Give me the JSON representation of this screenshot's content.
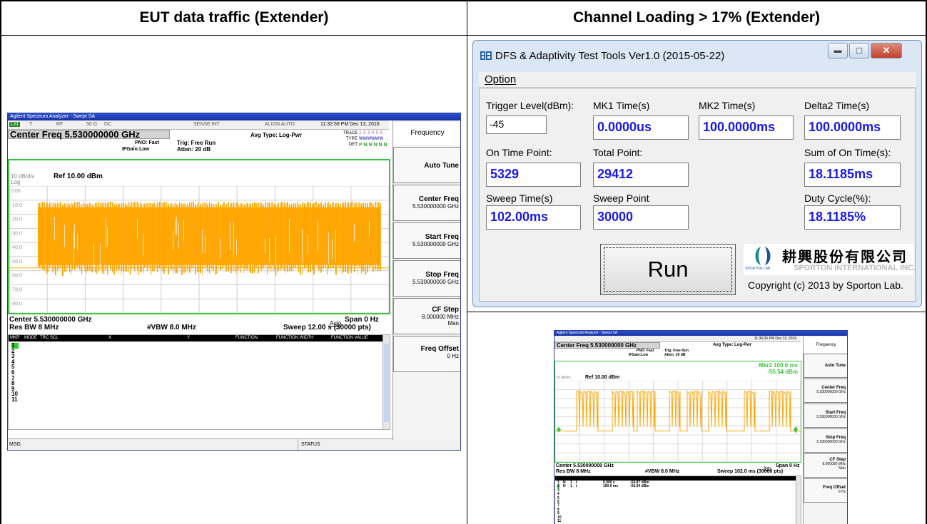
{
  "headers": {
    "left": "EUT data traffic (Extender)",
    "right": "Channel Loading > 17% (Extender)"
  },
  "sa_large": {
    "window_title": "Agilent Spectrum Analyzer - Swept SA",
    "status": {
      "lxi": "LXI",
      "t": "T",
      "rf": "RF",
      "ohm": "50 Ω",
      "dc": "DC",
      "sense": "SENSE:INT",
      "align": "ALIGN AUTO",
      "datetime": "11:32:59 PM Dec 13, 2016"
    },
    "center_freq": "Center Freq 5.530000000 GHz",
    "pno": "PNO: Fast",
    "ifgain": "IFGain:Low",
    "trig": "Trig: Free Run",
    "atten": "Atten: 20 dB",
    "avg_type": "Avg Type: Log-Pwr",
    "trace_lab": "TRACE",
    "trace_val": "1 2 3 4 5 6",
    "type_lab": "TYPE",
    "type_val": "WWWWWW",
    "det_lab": "DET",
    "det_val": "P N N N N N",
    "scale": "10 dB/div",
    "log": "Log",
    "ref": "Ref 10.00 dBm",
    "ylabels": [
      "0.00",
      "-10.0",
      "-20.0",
      "-30.0",
      "-40.0",
      "-50.0",
      "-60.0",
      "-70.0",
      "-80.0"
    ],
    "center_bottom": "Center 5.530000000 GHz",
    "res_bw": "Res BW 8 MHz",
    "vbw": "#VBW 8.0 MHz",
    "span": "Span 0 Hz",
    "sweep": "Sweep  12.00 s (30000 pts)",
    "table_cols": [
      "MKR",
      "MODE",
      "TRC",
      "SCL",
      "X",
      "Y",
      "FUNCTION",
      "FUNCTION WIDTH",
      "FUNCTION VALUE"
    ],
    "rows": [
      "1",
      "2",
      "3",
      "4",
      "5",
      "6",
      "7",
      "8",
      "9",
      "10",
      "11"
    ],
    "msg": "MSG",
    "status_lbl": "STATUS",
    "side": {
      "title": "Frequency",
      "auto_tune": "Auto Tune",
      "center_freq": "Center Freq",
      "center_val": "5.530000000 GHz",
      "start_freq": "Start Freq",
      "start_val": "5.530000000 GHz",
      "stop_freq": "Stop Freq",
      "stop_val": "5.530000000 GHz",
      "cf_step": "CF Step",
      "cf_val": "8.000000 MHz",
      "auto": "Auto",
      "man": "Man",
      "freq_offset": "Freq Offset",
      "offset_val": "0 Hz"
    }
  },
  "dialog": {
    "title": "DFS & Adaptivity Test Tools Ver1.0 (2015-05-22)",
    "menu_option": "Option",
    "trigger_label": "Trigger Level(dBm):",
    "trigger_value": "-45",
    "mk1_label": "MK1 Time(s)",
    "mk1_value": "0.0000us",
    "mk2_label": "MK2 Time(s)",
    "mk2_value": "100.0000ms",
    "delta2_label": "Delta2 Time(s)",
    "delta2_value": "100.0000ms",
    "on_time_label": "On Time Point:",
    "on_time_value": "5329",
    "total_label": "Total Point:",
    "total_value": "29412",
    "sum_label": "Sum of On Time(s):",
    "sum_value": "18.1185ms",
    "sweep_time_label": "Sweep Time(s)",
    "sweep_time_value": "102.00ms",
    "sweep_point_label": "Sweep Point",
    "sweep_point_value": "30000",
    "duty_label": "Duty Cycle(%):",
    "duty_value": "18.1185%",
    "run": "Run",
    "company_cn": "耕興股份有限公司",
    "company_en": "SPORTON INTERNATIONAL INC.",
    "lab_tag": "SPORTON LAB.",
    "copyright": "Copyright (c) 2013 by Sporton Lab."
  },
  "sa_small": {
    "window_title": "Agilent Spectrum Analyzer - Swept SA",
    "datetime": "11:36:26 PM Dec 13, 2016",
    "center_freq": "Center Freq 5.530000000 GHz",
    "pno": "PNO: Fast",
    "ifgain": "IFGain:Low",
    "trig": "Trig: Free Run",
    "atten": "Atten: 20 dB",
    "avg_type": "Avg Type: Log-Pwr",
    "marker_readout": "Mkr2 100.0 ms",
    "marker_level": "-55.54 dBm",
    "scale": "10 dB/div",
    "ref": "Ref 10.00 dBm",
    "center_bottom": "Center 5.530000000 GHz",
    "res_bw": "Res BW 8 MHz",
    "vbw": "#VBW 8.0 MHz",
    "span": "Span 0 Hz",
    "sweep": "Sweep  102.0 ms (30000 pts)",
    "marker_rows": [
      {
        "n": "1",
        "mode": "N",
        "trc": "1",
        "scl": "t",
        "x": "0.000 s",
        "y": "-54.87 dBm"
      },
      {
        "n": "2",
        "mode": "N",
        "trc": "1",
        "scl": "t",
        "x": "100.0 ms",
        "y": "-55.54 dBm"
      }
    ],
    "rows_rest": [
      "3",
      "4",
      "5",
      "6",
      "7",
      "8",
      "9",
      "10",
      "11"
    ],
    "side": {
      "title": "Frequency",
      "auto_tune": "Auto Tune",
      "center_freq": "Center Freq",
      "center_val": "5.530000000 GHz",
      "start_freq": "Start Freq",
      "start_val": "5.530000000 GHz",
      "stop_freq": "Stop Freq",
      "stop_val": "5.530000000 GHz",
      "cf_step": "CF Step",
      "cf_val": "8.000000 MHz",
      "auto": "Auto",
      "man": "Man",
      "freq_offset": "Freq Offset",
      "offset_val": "0 Hz"
    }
  },
  "colors": {
    "trace": "#ffa500",
    "grid_border": "#3fc43f",
    "value_text": "#1a1ae6"
  }
}
